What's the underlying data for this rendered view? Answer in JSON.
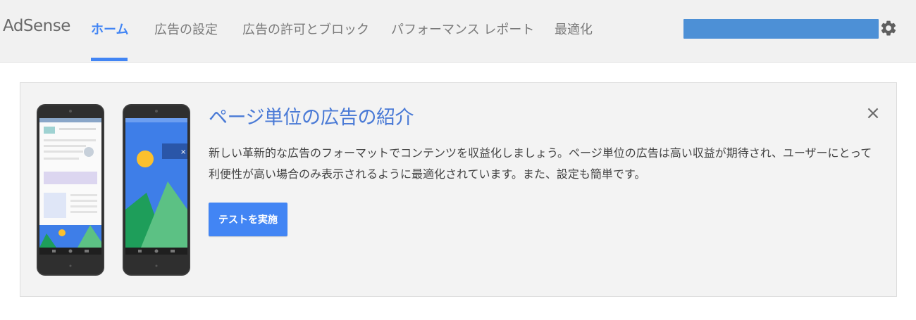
{
  "header": {
    "brand": "AdSense",
    "tabs": [
      {
        "label": "ホーム",
        "active": true
      },
      {
        "label": "広告の設定",
        "active": false
      },
      {
        "label": "広告の許可とブロック",
        "active": false
      },
      {
        "label": "パフォーマンス レポート",
        "active": false
      },
      {
        "label": "最適化",
        "active": false
      }
    ],
    "settings_icon": "gear-icon"
  },
  "promo": {
    "title": "ページ単位の広告の紹介",
    "body": "新しい革新的な広告のフォーマットでコンテンツを収益化しましょう。ページ単位の広告は高い収益が期待され、ユーザーにとって利便性が高い場合のみ表示されるように最適化されています。また、設定も簡単です。",
    "button_label": "テストを実施",
    "close_icon": "×"
  },
  "colors": {
    "accent": "#4285f4",
    "topbar_bg": "#f1f1f1",
    "card_bg": "#f3f3f3",
    "title": "#4a7ad6",
    "phone_screen_blue": "#3e7ee8",
    "hill_dark": "#1e9e5a",
    "hill_light": "#5cc184",
    "sun": "#fbc02d"
  }
}
